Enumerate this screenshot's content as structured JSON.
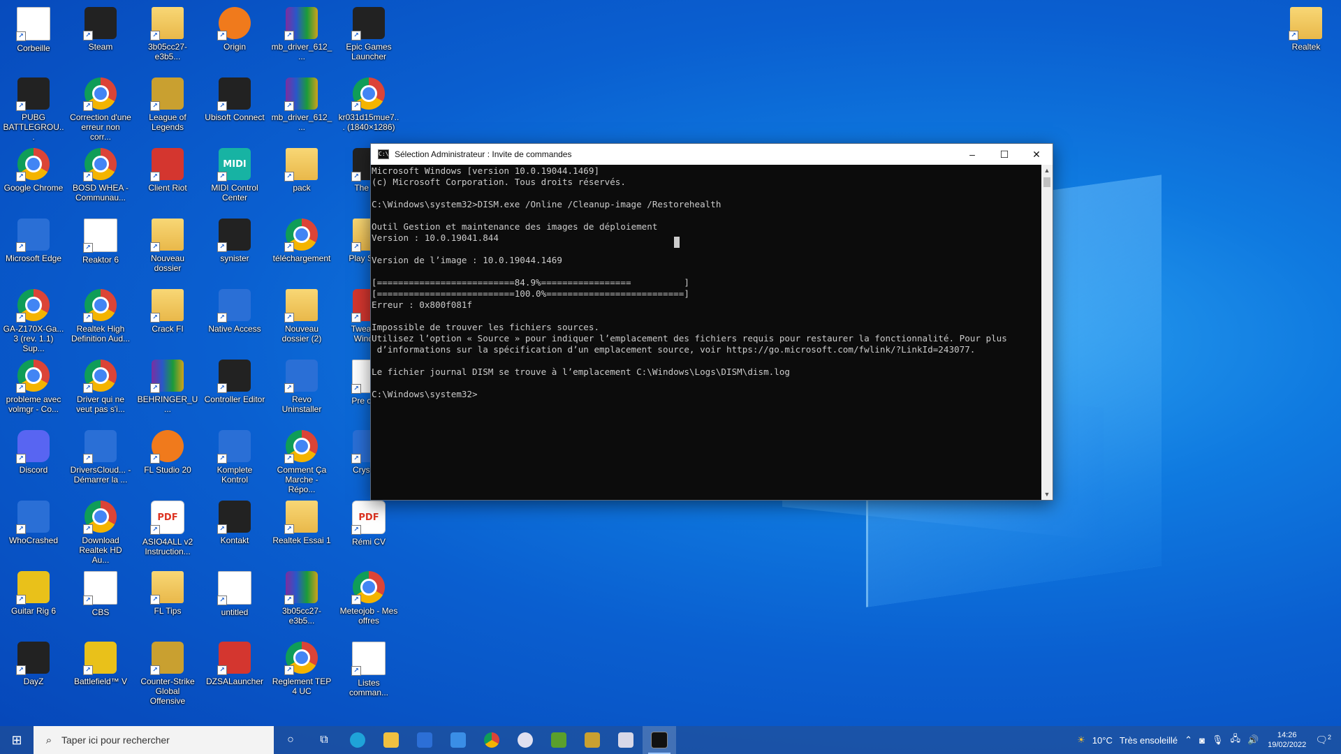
{
  "desktop": {
    "icons": [
      {
        "label": "Corbeille"
      },
      {
        "label": "Steam"
      },
      {
        "label": "3b05cc27-e3b5..."
      },
      {
        "label": "Origin"
      },
      {
        "label": "mb_driver_612_..."
      },
      {
        "label": "Epic Games Launcher"
      },
      {
        "label": "PUBG BATTLEGROU..."
      },
      {
        "label": "Correction d'une erreur non corr..."
      },
      {
        "label": "League of Legends"
      },
      {
        "label": "Ubisoft Connect"
      },
      {
        "label": "mb_driver_612_..."
      },
      {
        "label": "kr031d15mue7... (1840×1286)"
      },
      {
        "label": "Google Chrome"
      },
      {
        "label": "BOSD WHEA - Communau..."
      },
      {
        "label": "Client Riot"
      },
      {
        "label": "MIDI Control Center"
      },
      {
        "label": "pack"
      },
      {
        "label": "The 3rd"
      },
      {
        "label": "Microsoft Edge"
      },
      {
        "label": "Reaktor 6"
      },
      {
        "label": "Nouveau dossier"
      },
      {
        "label": "synister"
      },
      {
        "label": "téléchargement"
      },
      {
        "label": "Play Synth"
      },
      {
        "label": "GA-Z170X-Ga... 3 (rev. 1.1) Sup..."
      },
      {
        "label": "Realtek High Definition Aud..."
      },
      {
        "label": "Crack FI"
      },
      {
        "label": "Native Access"
      },
      {
        "label": "Nouveau dossier (2)"
      },
      {
        "label": "Tweaking Window"
      },
      {
        "label": "probleme avec volmgr - Co..."
      },
      {
        "label": "Driver qui ne veut pas s'i..."
      },
      {
        "label": "BEHRINGER_U..."
      },
      {
        "label": "Controller Editor"
      },
      {
        "label": "Revo Uninstaller"
      },
      {
        "label": "Pre corru"
      },
      {
        "label": "Discord"
      },
      {
        "label": "DriversCloud... - Démarrer la ..."
      },
      {
        "label": "FL Studio 20"
      },
      {
        "label": "Komplete Kontrol"
      },
      {
        "label": "Comment Ça Marche - Répo..."
      },
      {
        "label": "CrystalD"
      },
      {
        "label": "WhoCrashed"
      },
      {
        "label": "Download Realtek HD Au..."
      },
      {
        "label": "ASIO4ALL v2 Instruction..."
      },
      {
        "label": "Kontakt"
      },
      {
        "label": "Realtek Essai 1"
      },
      {
        "label": "Rémi CV"
      },
      {
        "label": "Guitar Rig 6"
      },
      {
        "label": "CBS"
      },
      {
        "label": "FL Tips"
      },
      {
        "label": "untitled"
      },
      {
        "label": "3b05cc27-e3b5..."
      },
      {
        "label": "Meteojob - Mes offres"
      },
      {
        "label": "DayZ"
      },
      {
        "label": "Battlefield™ V"
      },
      {
        "label": "Counter-Strike Global Offensive"
      },
      {
        "label": "DZSALauncher"
      },
      {
        "label": "Reglement TEP 4 UC"
      },
      {
        "label": "Listes comman..."
      },
      {
        "label": "Realtek"
      }
    ]
  },
  "cmd": {
    "title": "Sélection Administrateur : Invite de commandes",
    "minimize": "–",
    "maximize": "☐",
    "close": "✕",
    "lines": [
      "Microsoft Windows [version 10.0.19044.1469]",
      "(c) Microsoft Corporation. Tous droits réservés.",
      "",
      "C:\\Windows\\system32>DISM.exe /Online /Cleanup-image /Restorehealth",
      "",
      "Outil Gestion et maintenance des images de déploiement",
      "Version : 10.0.19041.844",
      "",
      "Version de l’image : 10.0.19044.1469",
      "",
      "[==========================84.9%=================          ]",
      "[==========================100.0%==========================]",
      "Erreur : 0x800f081f",
      "",
      "Impossible de trouver les fichiers sources.",
      "Utilisez l’option « Source » pour indiquer l’emplacement des fichiers requis pour restaurer la fonctionnalité. Pour plus",
      " d’informations sur la spécification d’un emplacement source, voir https://go.microsoft.com/fwlink/?LinkId=243077.",
      "",
      "Le fichier journal DISM se trouve à l’emplacement C:\\Windows\\Logs\\DISM\\dism.log",
      "",
      "C:\\Windows\\system32>"
    ]
  },
  "taskbar": {
    "start_icon": "windows-logo-icon",
    "search_placeholder": "Taper ici pour rechercher",
    "weather_temp": "10°C",
    "weather_text": "Très ensoleillé",
    "time": "14:26",
    "date": "19/02/2022",
    "notification_count": "2"
  },
  "colors": {
    "desktop_blue": "#0a5fd0",
    "console_bg": "#0c0c0c",
    "console_text": "#cccccc"
  }
}
